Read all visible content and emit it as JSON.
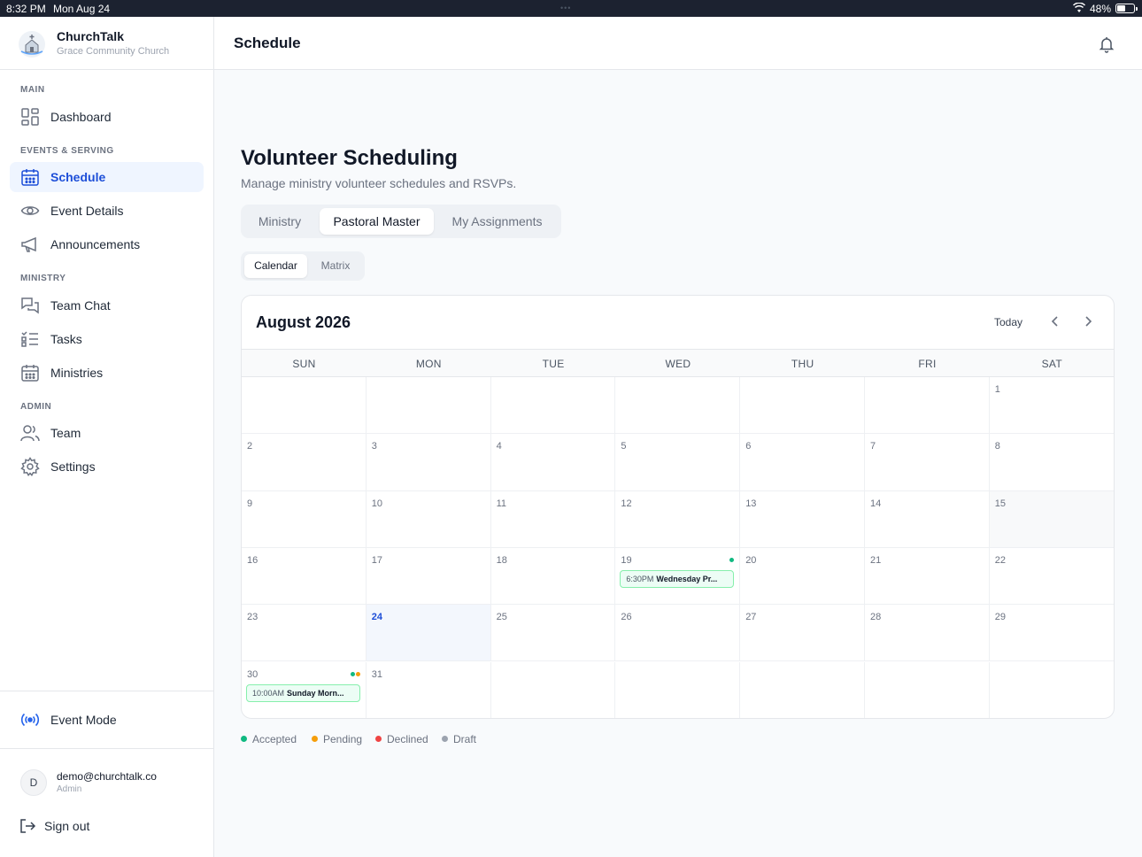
{
  "status_bar": {
    "time": "8:32 PM",
    "date": "Mon Aug 24",
    "battery": "48%"
  },
  "brand": {
    "name": "ChurchTalk",
    "org": "Grace Community Church"
  },
  "sidebar": {
    "sections": [
      "MAIN",
      "EVENTS & SERVING",
      "MINISTRY",
      "ADMIN"
    ],
    "items": [
      {
        "label": "Dashboard",
        "icon": "grid-icon"
      },
      {
        "label": "Schedule",
        "icon": "calendar-icon",
        "active": true
      },
      {
        "label": "Event Details",
        "icon": "eye-icon"
      },
      {
        "label": "Announcements",
        "icon": "megaphone-icon"
      },
      {
        "label": "Team Chat",
        "icon": "chat-icon"
      },
      {
        "label": "Tasks",
        "icon": "checklist-icon"
      },
      {
        "label": "Ministries",
        "icon": "calendar-icon"
      },
      {
        "label": "Team",
        "icon": "users-icon"
      },
      {
        "label": "Settings",
        "icon": "gear-icon"
      }
    ],
    "event_mode": "Event Mode",
    "user": {
      "initial": "D",
      "email": "demo@churchtalk.co",
      "role": "Admin"
    },
    "sign_out": "Sign out"
  },
  "header": {
    "title": "Schedule"
  },
  "main": {
    "title": "Volunteer Scheduling",
    "subtitle": "Manage ministry volunteer schedules and RSVPs.",
    "tabs": [
      "Ministry",
      "Pastoral Master",
      "My Assignments"
    ],
    "active_tab": "Pastoral Master",
    "view_tabs": [
      "Calendar",
      "Matrix"
    ],
    "active_view": "Calendar"
  },
  "calendar": {
    "month": "August 2026",
    "today_label": "Today",
    "weekdays": [
      "SUN",
      "MON",
      "TUE",
      "WED",
      "THU",
      "FRI",
      "SAT"
    ],
    "first_weekday_index": 6,
    "days_in_month": 31,
    "today": 24,
    "events": [
      {
        "day": 19,
        "time": "6:30PM",
        "title": "Wednesday Pr...",
        "dots": [
          "accepted"
        ]
      },
      {
        "day": 30,
        "time": "10:00AM",
        "title": "Sunday Morn...",
        "dots": [
          "accepted",
          "pending"
        ]
      }
    ]
  },
  "legend": [
    {
      "label": "Accepted",
      "color": "#10b981"
    },
    {
      "label": "Pending",
      "color": "#f59e0b"
    },
    {
      "label": "Declined",
      "color": "#ef4444"
    },
    {
      "label": "Draft",
      "color": "#9ca3af"
    }
  ],
  "colors": {
    "accent": "#1d4ed8",
    "accepted": "#10b981",
    "pending": "#f59e0b"
  }
}
